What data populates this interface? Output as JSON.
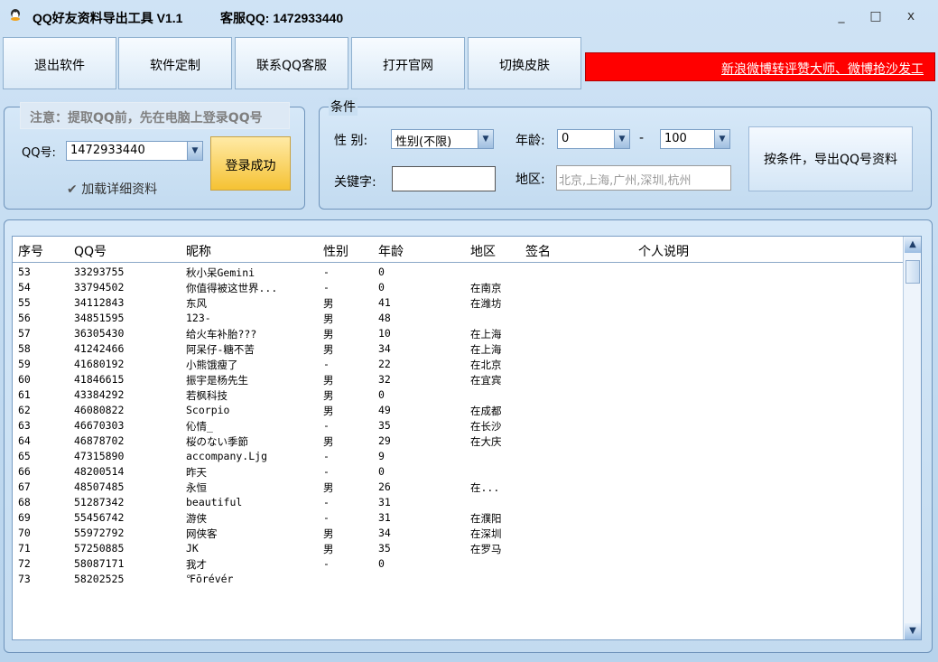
{
  "titlebar": {
    "title": "QQ好友资料导出工具 V1.1",
    "support": "客服QQ: 1472933440",
    "minimize": "_",
    "maximize": "□",
    "close": "x"
  },
  "toolbar": {
    "buttons": [
      "退出软件",
      "软件定制",
      "联系QQ客服",
      "打开官网",
      "切换皮肤"
    ],
    "marquee": "新浪微博转评赞大师、微博抢沙发工"
  },
  "login": {
    "notice": "注意：提取QQ前，先在电脑上登录QQ号",
    "qq_label": "QQ号:",
    "qq_value": "1472933440",
    "button": "登录成功",
    "checkbox_label": "加载详细资料",
    "checkbox_checked": true
  },
  "conditions": {
    "legend": "条件",
    "gender_label": "性  别:",
    "gender_value": "性别(不限)",
    "age_label": "年龄:",
    "age_min": "0",
    "age_sep": "-",
    "age_max": "100",
    "keyword_label": "关键字:",
    "keyword_value": "",
    "region_label": "地区:",
    "region_placeholder": "北京,上海,广州,深圳,杭州",
    "export_button": "按条件，导出QQ号资料"
  },
  "table": {
    "columns": [
      "序号",
      "QQ号",
      "昵称",
      "性别",
      "年龄",
      "地区",
      "签名",
      "个人说明"
    ],
    "rows": [
      [
        "53",
        "33293755",
        "秋小呆Gemini",
        "-",
        "0",
        ""
      ],
      [
        "54",
        "33794502",
        "你值得被这世界...",
        "-",
        "0",
        "在南京"
      ],
      [
        "55",
        "34112843",
        "东风",
        "男",
        "41",
        "在潍坊"
      ],
      [
        "56",
        "34851595",
        "123-",
        "男",
        "48",
        ""
      ],
      [
        "57",
        "36305430",
        "给火车补胎???",
        "男",
        "10",
        "在上海"
      ],
      [
        "58",
        "41242466",
        "阿呆仔-糖不苦",
        "男",
        "34",
        "在上海"
      ],
      [
        "59",
        "41680192",
        "小熊饿瘦了",
        "-",
        "22",
        "在北京"
      ],
      [
        "60",
        "41846615",
        "振宇是杨先生",
        "男",
        "32",
        "在宜宾"
      ],
      [
        "61",
        "43384292",
        "若枫科技",
        "男",
        "0",
        ""
      ],
      [
        "62",
        "46080822",
        "Scorpio",
        "男",
        "49",
        "在成都"
      ],
      [
        "63",
        "46670303",
        "伈情_",
        "-",
        "35",
        "在长沙"
      ],
      [
        "64",
        "46878702",
        "桜のない季節",
        "男",
        "29",
        "在大庆"
      ],
      [
        "65",
        "47315890",
        "accompany.Ljg",
        "-",
        "9",
        ""
      ],
      [
        "66",
        "48200514",
        "昨天",
        "-",
        "0",
        ""
      ],
      [
        "67",
        "48507485",
        "永恒",
        "男",
        "26",
        "在..."
      ],
      [
        "68",
        "51287342",
        "beautiful",
        "-",
        "31",
        ""
      ],
      [
        "69",
        "55456742",
        "游侠",
        "-",
        "31",
        "在濮阳"
      ],
      [
        "70",
        "55972792",
        "网侠客",
        "男",
        "34",
        "在深圳"
      ],
      [
        "71",
        "57250885",
        "JK",
        "男",
        "35",
        "在罗马"
      ],
      [
        "72",
        "58087171",
        "我才",
        "-",
        "0",
        ""
      ],
      [
        "73",
        "58202525",
        "℉ōrévér",
        "",
        "",
        ""
      ]
    ]
  }
}
